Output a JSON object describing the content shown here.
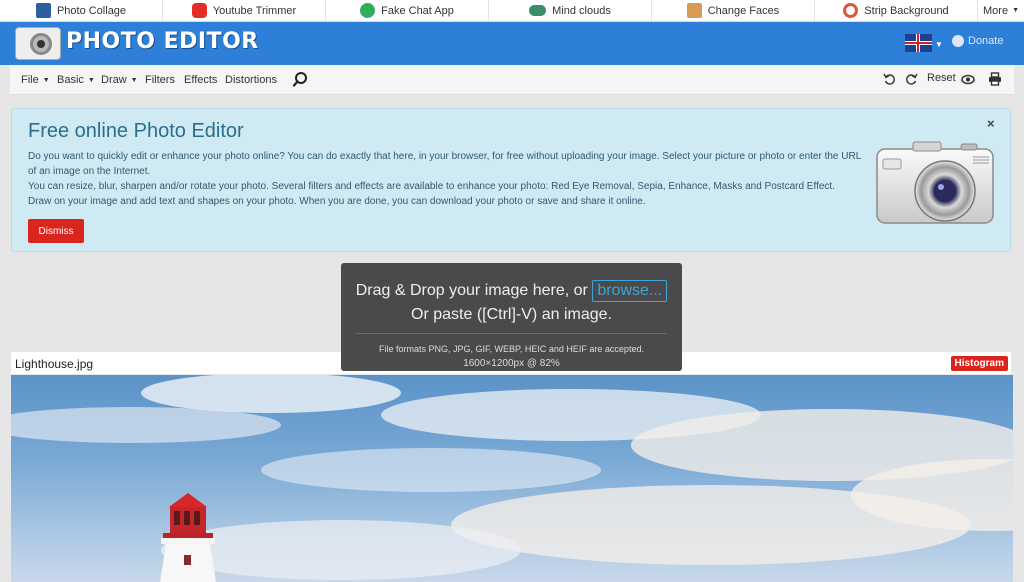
{
  "topbar": {
    "items": [
      {
        "label": "Photo Collage",
        "icon": "collage-icon",
        "color": "#2d5fa0"
      },
      {
        "label": "Youtube Trimmer",
        "icon": "youtube-icon",
        "color": "#e52d27"
      },
      {
        "label": "Fake Chat App",
        "icon": "chat-icon",
        "color": "#2fae5a"
      },
      {
        "label": "Mind clouds",
        "icon": "cloud-icon",
        "color": "#3a8f6a"
      },
      {
        "label": "Change Faces",
        "icon": "face-icon",
        "color": "#d99a55"
      },
      {
        "label": "Strip Background",
        "icon": "strip-icon",
        "color": "#e0553a"
      }
    ],
    "more_label": "More"
  },
  "header": {
    "logo_text": "PHOTO EDITOR",
    "donate_label": "Donate",
    "accent": "#2d7fd8"
  },
  "toolbar": {
    "menus": [
      "File",
      "Basic",
      "Draw",
      "Filters",
      "Effects",
      "Distortions"
    ],
    "reset_label": "Reset"
  },
  "info": {
    "title": "Free online Photo Editor",
    "p1": "Do you want to quickly edit or enhance your photo online? You can do exactly that here, in your browser, for free without uploading your image. Select your picture or photo or enter the URL of an image on the Internet.",
    "p2": "You can resize, blur, sharpen and/or rotate your photo. Several filters and effects are available to enhance your photo: Red Eye Removal, Sepia, Enhance, Masks and Postcard Effect.",
    "p3": "Draw on your image and add text and shapes on your photo. When you are done, you can download your photo or save and share it online.",
    "dismiss_label": "Dismiss",
    "close_glyph": "×"
  },
  "dropzone": {
    "line1": "Drag & Drop your image here, or",
    "browse_label": "browse...",
    "line2": "Or paste ([Ctrl]-V) an image.",
    "formats": "File formats PNG, JPG, GIF, WEBP, HEIC and HEIF are accepted.",
    "size_info": "1600×1200px @  82%"
  },
  "image": {
    "filename": "Lighthouse.jpg",
    "histogram_label": "Histogram"
  }
}
